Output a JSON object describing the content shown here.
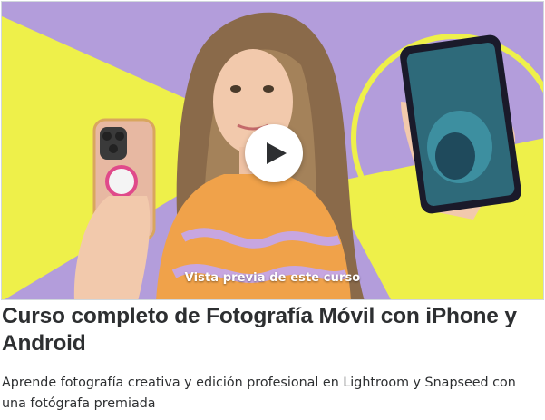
{
  "preview": {
    "label": "Vista previa de este curso",
    "play_icon": "play-icon",
    "colors": {
      "background": "#b39ddb",
      "accent_yellow": "#eef04a",
      "play_button": "#ffffff",
      "play_glyph": "#2d2f31"
    }
  },
  "course": {
    "title": "Curso completo de Fotografía Móvil con iPhone y Android",
    "subtitle": "Aprende fotografía creativa y edición profesional en Lightroom y Snapseed con una fotógrafa premiada"
  },
  "colors": {
    "text": "#2d2f31",
    "border": "#d1d7dc"
  }
}
